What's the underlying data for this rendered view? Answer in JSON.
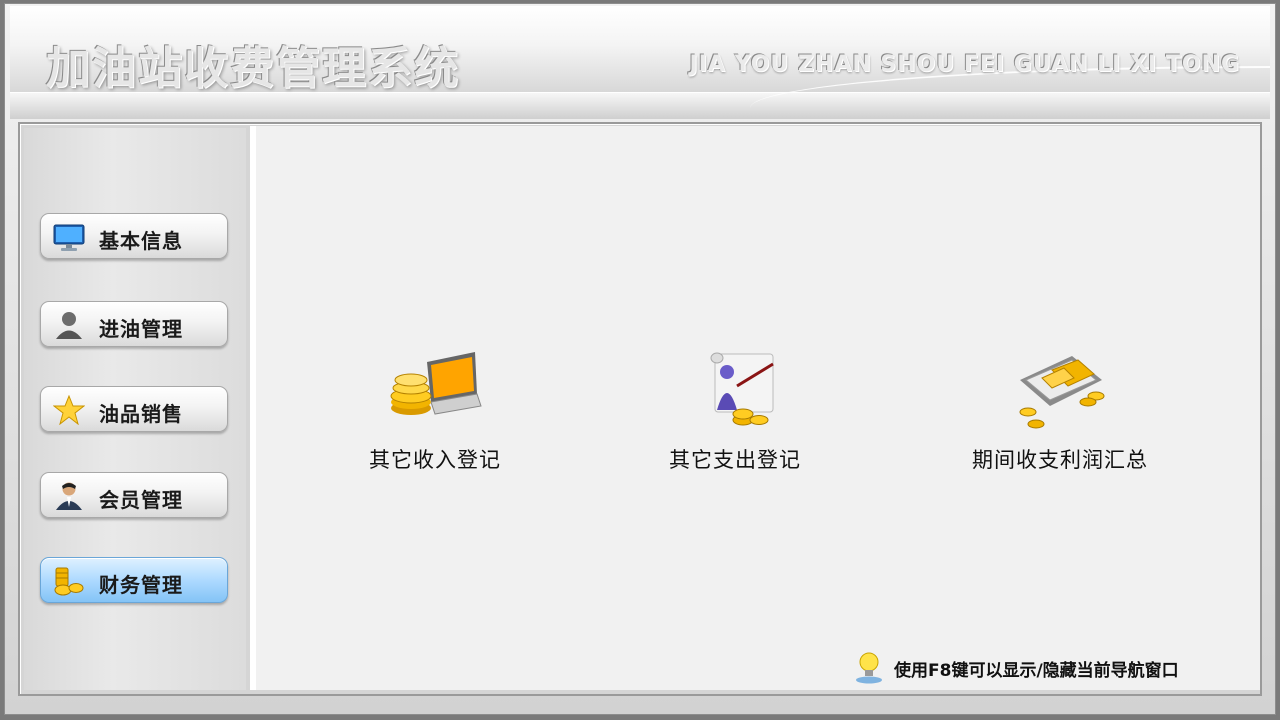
{
  "header": {
    "title": "加油站收费管理系统",
    "subtitle": "JIA YOU ZHAN SHOU FEI GUAN LI XI TONG"
  },
  "sidebar": {
    "items": [
      {
        "label": "基本信息",
        "icon": "monitor-icon",
        "active": false
      },
      {
        "label": "进油管理",
        "icon": "person-icon",
        "active": false
      },
      {
        "label": "油品销售",
        "icon": "star-icon",
        "active": false
      },
      {
        "label": "会员管理",
        "icon": "user-suit-icon",
        "active": false
      },
      {
        "label": "财务管理",
        "icon": "coins-icon",
        "active": true
      }
    ]
  },
  "main": {
    "actions": [
      {
        "label": "其它收入登记",
        "icon": "laptop-coins-icon"
      },
      {
        "label": "其它支出登记",
        "icon": "presenter-coins-icon"
      },
      {
        "label": "期间收支利润汇总",
        "icon": "ledger-coins-icon"
      }
    ]
  },
  "footer_hint": {
    "label": "使用F8键可以显示/隐藏当前导航窗口",
    "icon": "lightbulb-icon"
  },
  "colors": {
    "active_nav": "#aedaff",
    "coin_gold": "#f2b400",
    "main_bg": "#f1f1f1"
  }
}
